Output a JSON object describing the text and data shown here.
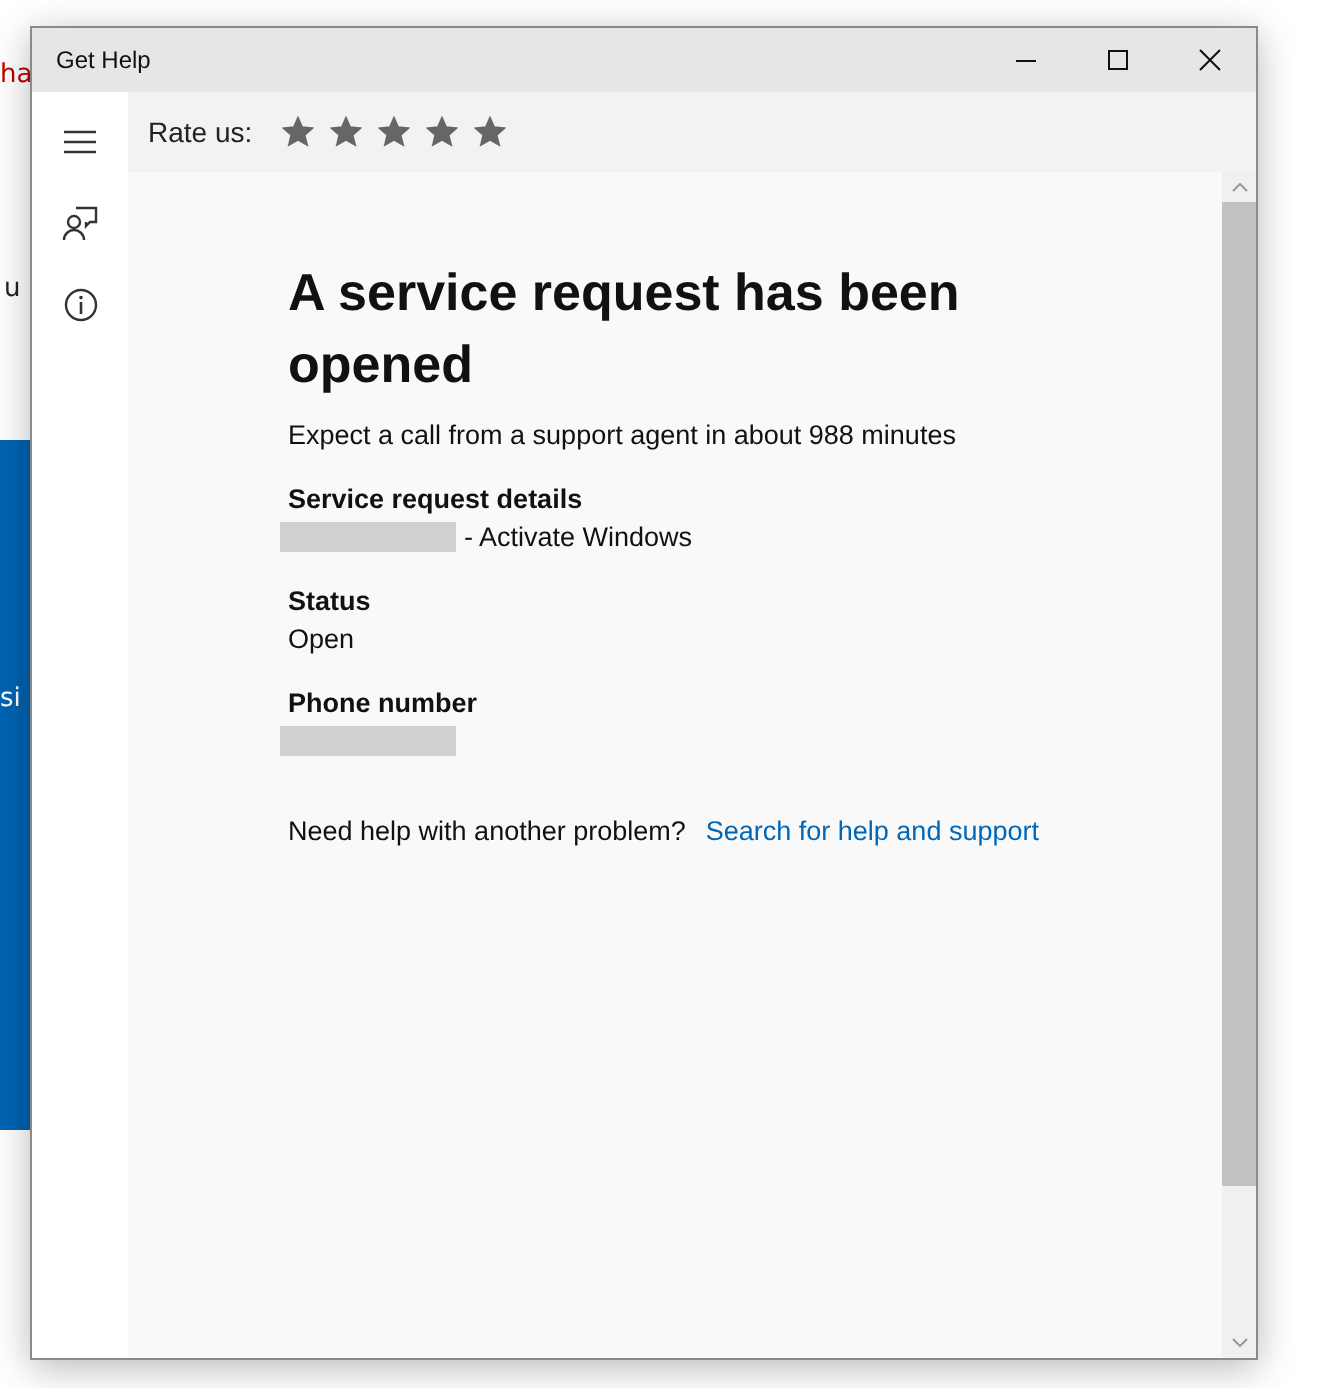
{
  "background_window": {
    "texts": [
      {
        "kind": "red",
        "text": "ha"
      },
      {
        "kind": "plain",
        "text": "u"
      },
      {
        "kind": "blue",
        "text": "si"
      }
    ]
  },
  "window": {
    "title": "Get Help"
  },
  "rating": {
    "label": "Rate us:",
    "stars": 5
  },
  "heading": "A service request has been opened",
  "subtitle": "Expect a call from a support agent in about 988 minutes",
  "details": [
    {
      "label": "Service request details",
      "value": "- Activate Windows",
      "redacted": true
    },
    {
      "label": "Status",
      "value": "Open",
      "redacted": false
    },
    {
      "label": "Phone number",
      "redacted": true
    }
  ],
  "help": {
    "text": "Need help with another problem?",
    "link": "Search for help and support"
  }
}
